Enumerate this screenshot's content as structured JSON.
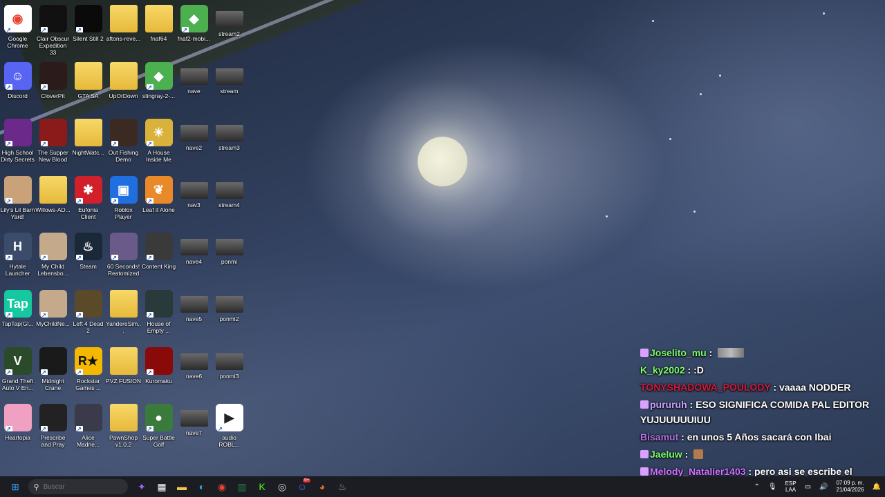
{
  "desktop_icons": [
    {
      "label": "Google Chrome",
      "icon": "chrome-icon",
      "color": "#ffffff"
    },
    {
      "label": "Clair Obscur Expedition 33",
      "icon": "clair-obscur-icon",
      "color": "#111111"
    },
    {
      "label": "Silent Still 2",
      "icon": "silent-still-icon",
      "color": "#0a0a0a"
    },
    {
      "label": "aftons-reve...",
      "icon": "folder-icon",
      "color": "#f2c84b"
    },
    {
      "label": "fnaf64",
      "icon": "folder-icon",
      "color": "#f2c84b"
    },
    {
      "label": "fnaf2-mobi...",
      "icon": "bluestacks-icon",
      "color": "#4caf50"
    },
    {
      "label": "stream2",
      "icon": "video-thumbnail-icon",
      "color": "#555555"
    },
    {
      "label": "Discord",
      "icon": "discord-icon",
      "color": "#5865f2"
    },
    {
      "label": "CloverPit",
      "icon": "cloverpit-icon",
      "color": "#2b1b1b"
    },
    {
      "label": "GTA SA",
      "icon": "folder-icon",
      "color": "#f2c84b"
    },
    {
      "label": "UpOrDown",
      "icon": "folder-icon",
      "color": "#f2c84b"
    },
    {
      "label": "stingray-2-...",
      "icon": "bluestacks-icon",
      "color": "#4caf50"
    },
    {
      "label": "nave",
      "icon": "video-thumbnail-icon",
      "color": "#555555"
    },
    {
      "label": "stream",
      "icon": "video-thumbnail-icon",
      "color": "#555555"
    },
    {
      "label": "High School Dirty Secrets",
      "icon": "game-icon",
      "color": "#6b2a8a"
    },
    {
      "label": "The Supper New Blood",
      "icon": "the-supper-icon",
      "color": "#8b1a1a"
    },
    {
      "label": "NightWatc...",
      "icon": "folder-icon",
      "color": "#f2c84b"
    },
    {
      "label": "Out Fishing Demo",
      "icon": "game-icon",
      "color": "#3b2a22"
    },
    {
      "label": "A House Inside Me",
      "icon": "sun-icon",
      "color": "#d8b23a"
    },
    {
      "label": "nave2",
      "icon": "video-thumbnail-icon",
      "color": "#555555"
    },
    {
      "label": "stream3",
      "icon": "video-thumbnail-icon",
      "color": "#555555"
    },
    {
      "label": "Lily's Lil Barn Yard!",
      "icon": "game-icon",
      "color": "#c9a27a"
    },
    {
      "label": "Willows-AD...",
      "icon": "folder-icon",
      "color": "#f2c84b"
    },
    {
      "label": "Eufonia Client",
      "icon": "bug-icon",
      "color": "#d0202a"
    },
    {
      "label": "Roblox Player",
      "icon": "roblox-icon",
      "color": "#1f6fe0"
    },
    {
      "label": "Leaf it Alone",
      "icon": "leaf-icon",
      "color": "#e88a2a"
    },
    {
      "label": "nav3",
      "icon": "video-thumbnail-icon",
      "color": "#555555"
    },
    {
      "label": "stream4",
      "icon": "video-thumbnail-icon",
      "color": "#555555"
    },
    {
      "label": "Hytale Launcher",
      "icon": "hytale-icon",
      "color": "#3b4c6a"
    },
    {
      "label": "My Child Lebensbo...",
      "icon": "game-icon",
      "color": "#c4a98a"
    },
    {
      "label": "Steam",
      "icon": "steam-icon",
      "color": "#1b2838"
    },
    {
      "label": "60 Seconds! Reatomized",
      "icon": "game-icon",
      "color": "#6a5a8a"
    },
    {
      "label": "Content King",
      "icon": "content-king-icon",
      "color": "#3a3a3a"
    },
    {
      "label": "nave4",
      "icon": "video-thumbnail-icon",
      "color": "#555555"
    },
    {
      "label": "ponmi",
      "icon": "video-thumbnail-icon",
      "color": "#555555"
    },
    {
      "label": "TapTap(Gl...",
      "icon": "taptap-icon",
      "color": "#14c9a0"
    },
    {
      "label": "MyChildNe...",
      "icon": "game-icon",
      "color": "#c4a98a"
    },
    {
      "label": "Left 4 Dead 2",
      "icon": "left4dead-icon",
      "color": "#5a4a2a"
    },
    {
      "label": "YandereSim...",
      "icon": "folder-icon",
      "color": "#f2c84b"
    },
    {
      "label": "House of Empty ...",
      "icon": "game-icon",
      "color": "#2a3a3a"
    },
    {
      "label": "nave5",
      "icon": "video-thumbnail-icon",
      "color": "#555555"
    },
    {
      "label": "ponmi2",
      "icon": "video-thumbnail-icon",
      "color": "#555555"
    },
    {
      "label": "Grand Theft Auto V En...",
      "icon": "gta-v-icon",
      "color": "#2a4a2a"
    },
    {
      "label": "Midnight Crane",
      "icon": "game-icon",
      "color": "#1a1a1a"
    },
    {
      "label": "Rockstar Games ...",
      "icon": "rockstar-icon",
      "color": "#f5b800"
    },
    {
      "label": "PVZ FUSION",
      "icon": "folder-icon",
      "color": "#f2c84b"
    },
    {
      "label": "Kuromaku",
      "icon": "kuromaku-icon",
      "color": "#8a0a0a"
    },
    {
      "label": "nave6",
      "icon": "video-thumbnail-icon",
      "color": "#555555"
    },
    {
      "label": "ponmi3",
      "icon": "video-thumbnail-icon",
      "color": "#555555"
    },
    {
      "label": "Heartopia",
      "icon": "heartopia-icon",
      "color": "#f0a0c0"
    },
    {
      "label": "Prescribe and Pray",
      "icon": "prescribe-pray-icon",
      "color": "#222222"
    },
    {
      "label": "Alice Madne...",
      "icon": "game-icon",
      "color": "#3a3a4a"
    },
    {
      "label": "PawnShop v1.0.2",
      "icon": "folder-icon",
      "color": "#f2c84b"
    },
    {
      "label": "Super Battle Golf",
      "icon": "golf-icon",
      "color": "#3a7a3a"
    },
    {
      "label": "nave7",
      "icon": "video-thumbnail-icon",
      "color": "#555555"
    },
    {
      "label": "audio ROBL...",
      "icon": "audio-file-icon",
      "color": "#ffffff"
    }
  ],
  "chat": [
    {
      "user": "Joselito_mu",
      "color": "#7cfc6a",
      "badges": true,
      "text": "",
      "emote": "wide"
    },
    {
      "user": "K_ky2002",
      "color": "#7cfc6a",
      "badges": false,
      "text": ":D",
      "emote": ""
    },
    {
      "user": "TONYSHADOWA_POULODY",
      "color": "#d01a3a",
      "badges": false,
      "text": "vaaaa NODDER",
      "emote": ""
    },
    {
      "user": "pururuh",
      "color": "#c9a0ff",
      "badges": true,
      "text": "ESO SIGNIFICA COMIDA PAL EDITOR YUJUUUUUIUU",
      "emote": ""
    },
    {
      "user": "Bisamut",
      "color": "#b070e0",
      "badges": false,
      "text": "en unos 5 Años sacará con Ibai",
      "emote": ""
    },
    {
      "user": "Jaeluw",
      "color": "#7cfc6a",
      "badges": true,
      "text": "",
      "emote": "small"
    },
    {
      "user": "Melody_Natalier1403",
      "color": "#d070ff",
      "badges": true,
      "text": "pero asi se escribe el emote tilin",
      "emote": "small"
    }
  ],
  "taskbar": {
    "search_placeholder": "Buscar",
    "apps": [
      {
        "icon": "windows-start-icon",
        "color": "#3aa0ff"
      },
      {
        "icon": "copilot-icon",
        "color": "#9a6aff"
      },
      {
        "icon": "microsoft-store-icon",
        "color": "#ffffff"
      },
      {
        "icon": "file-explorer-icon",
        "color": "#f2c84b"
      },
      {
        "icon": "edge-icon",
        "color": "#2aa7e0"
      },
      {
        "icon": "chrome-icon",
        "color": "#ea4335"
      },
      {
        "icon": "excel-like-icon",
        "color": "#2a7a4a"
      },
      {
        "icon": "kick-icon",
        "color": "#53fc18"
      },
      {
        "icon": "obs-icon",
        "color": "#dddddd"
      },
      {
        "icon": "discord-icon",
        "color": "#5865f2",
        "badge": "9+"
      },
      {
        "icon": "firefox-icon",
        "color": "#e86a2a"
      },
      {
        "icon": "steam-icon",
        "color": "#9ab"
      }
    ],
    "lang_line1": "ESP",
    "lang_line2": "LAA",
    "time": "07:09 p. m.",
    "date": "21/04/2026"
  }
}
